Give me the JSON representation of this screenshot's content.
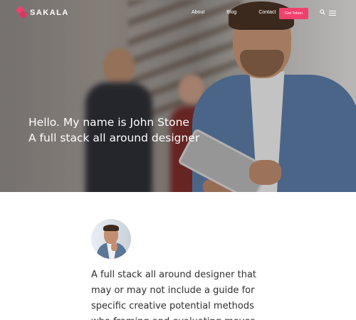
{
  "brand": {
    "name": "SAKALA",
    "accent": "#f0416c"
  },
  "nav": {
    "items": [
      {
        "label": "",
        "active": true
      },
      {
        "label": "About",
        "active": false
      },
      {
        "label": "Blog",
        "active": false
      },
      {
        "label": "Contact",
        "active": false
      }
    ],
    "cta_label": "Get Token",
    "icons": [
      "search-icon",
      "menu-icon"
    ]
  },
  "hero": {
    "line1": "Hello. My name is John Stone",
    "line2": "A full stack all around designer"
  },
  "content": {
    "bio": "A full stack all around designer that may or may not include a guide for specific creative potential methods who framing and evaluating moves"
  }
}
